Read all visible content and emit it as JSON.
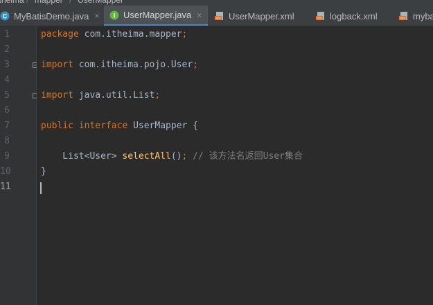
{
  "breadcrumb": [
    "itheima",
    "mapper",
    "UserMapper"
  ],
  "tabs": [
    {
      "label": "MyBatisDemo.java",
      "icon": "class-icon",
      "active": false
    },
    {
      "label": "UserMapper.java",
      "icon": "interface-icon",
      "active": true
    },
    {
      "label": "UserMapper.xml",
      "icon": "xml-file-icon",
      "active": false
    },
    {
      "label": "logback.xml",
      "icon": "xml-file-icon",
      "active": false
    },
    {
      "label": "myba",
      "icon": "xml-file-icon",
      "active": false
    }
  ],
  "tab_close_glyph": "×",
  "colors": {
    "accent": "#4a88c7",
    "keyword": "#cc7832",
    "method": "#ffc66d",
    "comment": "#808080",
    "text": "#a9b7c6",
    "background": "#2b2b2b"
  },
  "line_numbers": [
    "1",
    "2",
    "3",
    "4",
    "5",
    "6",
    "7",
    "8",
    "9",
    "10",
    "11"
  ],
  "code": {
    "l1_kw": "package",
    "l1_rest": " com.itheima.mapper",
    "l1_semi": ";",
    "l3_kw": "import",
    "l3_rest": " com.itheima.pojo.User",
    "l3_semi": ";",
    "l5_kw": "import",
    "l5_rest": " java.util.List",
    "l5_semi": ";",
    "l7_kw1": "public",
    "l7_kw2": "interface",
    "l7_rest": " UserMapper {",
    "l9_indent": "    List<User> ",
    "l9_method": "selectAll",
    "l9_paren": "()",
    "l9_semi": ";",
    "l9_comment": " // 该方法名返回User集合",
    "l10": "}"
  }
}
